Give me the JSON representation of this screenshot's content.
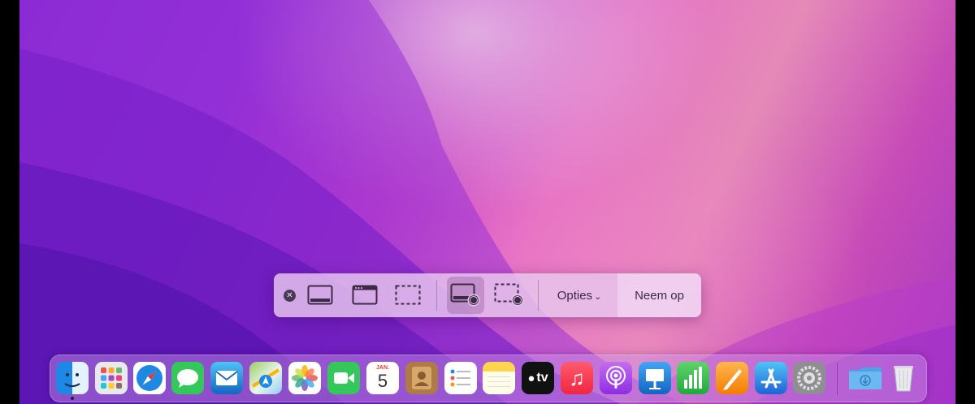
{
  "toolbar": {
    "close_icon": "close-icon",
    "modes": [
      {
        "name": "capture-entire-screen",
        "icon": "entire-screen-icon",
        "active": false
      },
      {
        "name": "capture-window",
        "icon": "window-icon",
        "active": false
      },
      {
        "name": "capture-selection",
        "icon": "selection-icon",
        "active": false
      },
      {
        "name": "record-entire-screen",
        "icon": "record-screen-icon",
        "active": true
      },
      {
        "name": "record-selection",
        "icon": "record-selection-icon",
        "active": false
      }
    ],
    "options_label": "Opties",
    "take_label": "Neem op"
  },
  "dock": {
    "apps": [
      {
        "name": "finder",
        "running": true
      },
      {
        "name": "launchpad",
        "running": false
      },
      {
        "name": "safari",
        "running": false
      },
      {
        "name": "messages",
        "running": false
      },
      {
        "name": "mail",
        "running": false
      },
      {
        "name": "maps",
        "running": false
      },
      {
        "name": "photos",
        "running": false
      },
      {
        "name": "facetime",
        "running": false
      },
      {
        "name": "calendar",
        "running": false,
        "month": "JAN.",
        "day": "5"
      },
      {
        "name": "contacts",
        "running": false
      },
      {
        "name": "reminders",
        "running": false
      },
      {
        "name": "notes",
        "running": false
      },
      {
        "name": "apple-tv",
        "running": false,
        "label": "tv"
      },
      {
        "name": "music",
        "running": false
      },
      {
        "name": "podcasts",
        "running": false
      },
      {
        "name": "keynote",
        "running": false
      },
      {
        "name": "numbers",
        "running": false
      },
      {
        "name": "pages",
        "running": false
      },
      {
        "name": "app-store",
        "running": false
      },
      {
        "name": "system-preferences",
        "running": false
      }
    ],
    "folders": [
      {
        "name": "downloads-folder"
      },
      {
        "name": "trash"
      }
    ]
  },
  "colors": {
    "wallpaper_primary": "#8a2bd8",
    "wallpaper_accent": "#e56fc4",
    "toolbar_bg": "#e8c8ee",
    "toolbar_text": "#3d2a47"
  }
}
